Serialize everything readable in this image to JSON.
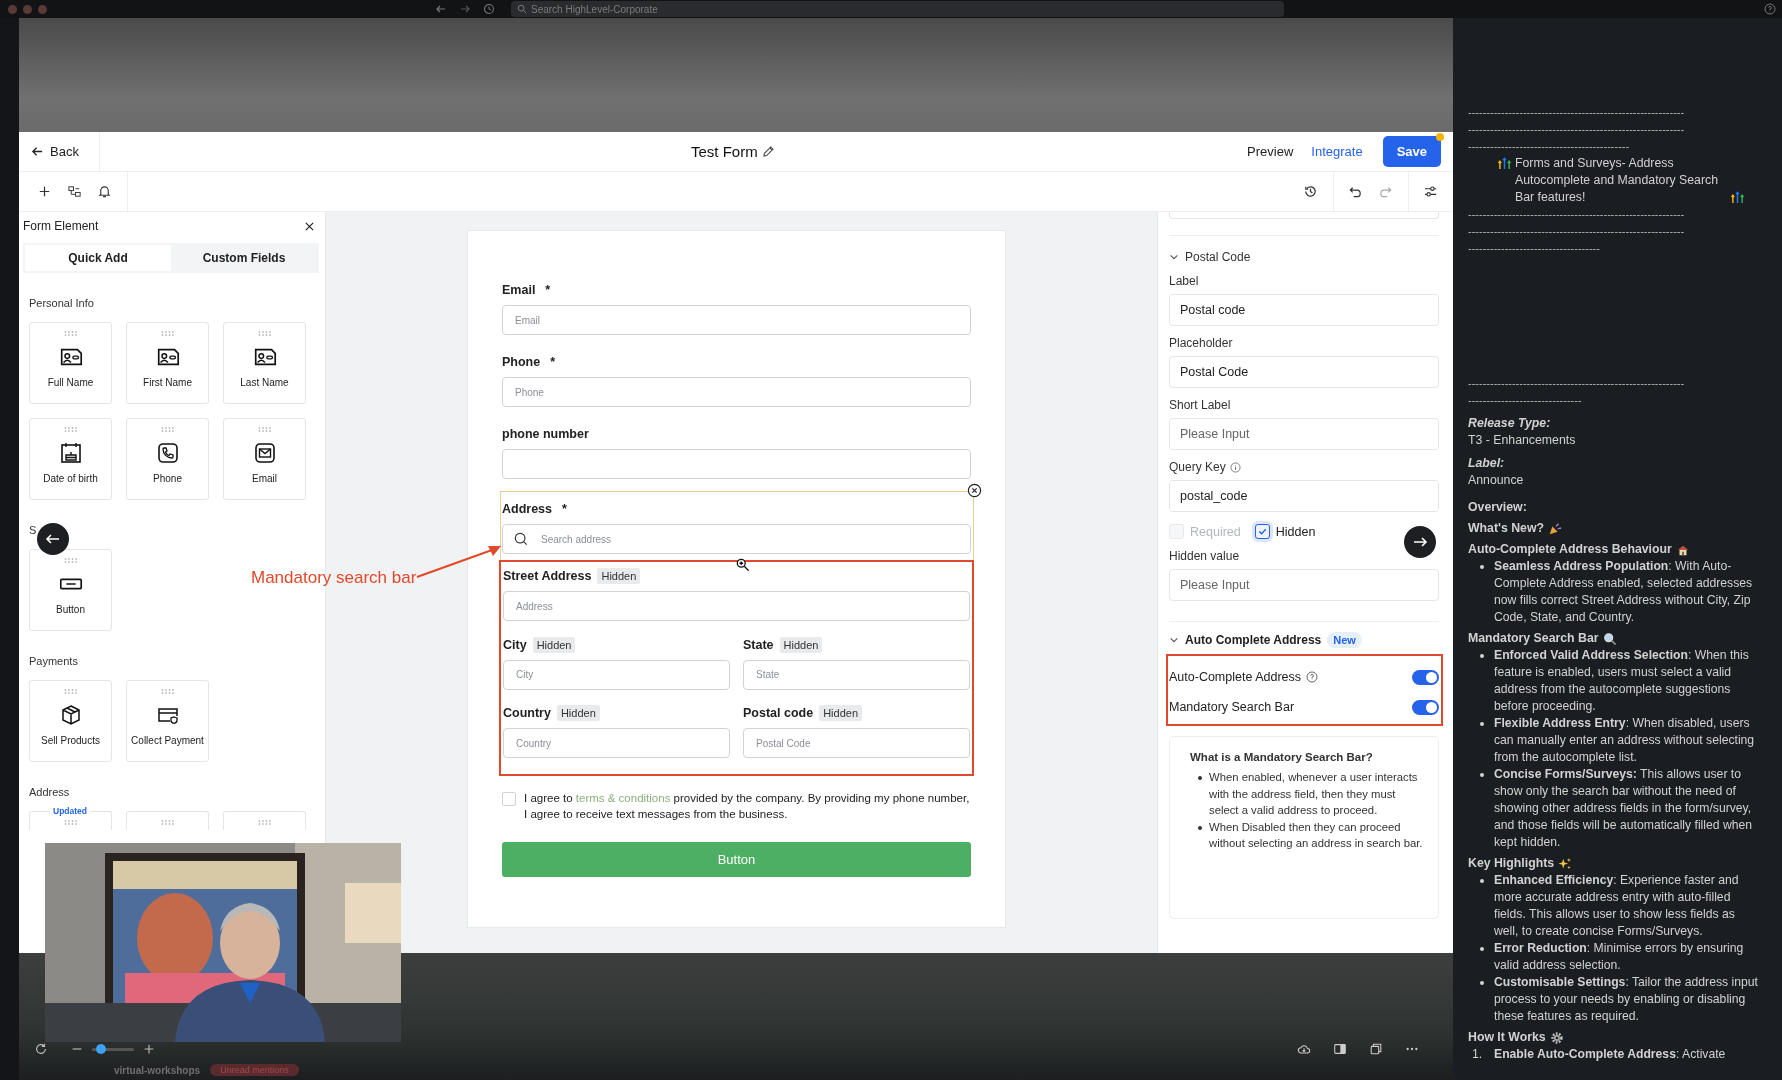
{
  "browser": {
    "search_placeholder": "Search HighLevel-Corporate"
  },
  "header": {
    "back": "Back",
    "title": "Test Form",
    "actions": [
      {
        "label": "Preview",
        "kind": "plain"
      },
      {
        "label": "Integrate",
        "kind": "link"
      },
      {
        "label": "Save",
        "kind": "primary"
      }
    ]
  },
  "left_panel": {
    "title": "Form Element",
    "tabs": [
      {
        "label": "Quick Add",
        "selected": true
      },
      {
        "label": "Custom Fields",
        "selected": false
      }
    ],
    "sections": [
      {
        "title": "Personal Info",
        "items": [
          {
            "label": "Full Name",
            "kind": "name"
          },
          {
            "label": "First Name",
            "kind": "name"
          },
          {
            "label": "Last Name",
            "kind": "name"
          },
          {
            "label": "Date of birth",
            "kind": "date"
          },
          {
            "label": "Phone",
            "kind": "phone"
          },
          {
            "label": "Email",
            "kind": "email"
          }
        ]
      },
      {
        "title": "S",
        "items": [
          {
            "label": "Button",
            "kind": "button"
          }
        ]
      },
      {
        "title": "Payments",
        "items": [
          {
            "label": "Sell Products",
            "kind": "product"
          },
          {
            "label": "Collect Payment",
            "kind": "payment"
          }
        ]
      },
      {
        "title": "Address",
        "items": [
          {
            "kind": "blank",
            "badge": "Updated"
          },
          {
            "kind": "blank"
          },
          {
            "kind": "blank"
          }
        ]
      }
    ]
  },
  "form": {
    "fields": [
      {
        "label": "Email",
        "required_mark": "*",
        "placeholder": "Email"
      },
      {
        "label": "Phone",
        "required_mark": "*",
        "placeholder": "Phone"
      },
      {
        "label": "phone number"
      }
    ],
    "address": {
      "label": "Address",
      "required_mark": "*",
      "search_placeholder": "Search address",
      "subfields": [
        {
          "label": "Street Address",
          "tag": "Hidden",
          "placeholder": "Address",
          "wide": true
        },
        {
          "label": "City",
          "tag": "Hidden",
          "placeholder": "City",
          "wide": false
        },
        {
          "label": "State",
          "tag": "Hidden",
          "placeholder": "State",
          "wide": false
        },
        {
          "label": "Country",
          "tag": "Hidden",
          "placeholder": "Country",
          "wide": false
        },
        {
          "label": "Postal code",
          "tag": "Hidden",
          "placeholder": "Postal Code",
          "wide": false
        }
      ]
    },
    "consent": {
      "checked": false,
      "before": "I agree to",
      "link": "terms & conditions",
      "after": "provided by the company. By providing my phone number, I agree to receive text messages from the business."
    },
    "submit": "Button"
  },
  "annotation": {
    "text": "Mandatory search bar"
  },
  "settings": {
    "section": "Postal Code",
    "fields": [
      {
        "label": "Label",
        "value": "Postal code",
        "info": false
      },
      {
        "label": "Placeholder",
        "value": "Postal Code",
        "info": false
      },
      {
        "label": "Short Label",
        "placeholder": "Please Input",
        "info": false
      },
      {
        "label": "Query Key",
        "value": "postal_code",
        "info": true
      }
    ],
    "checks": [
      {
        "label": "Required",
        "checked": false,
        "disabled": true
      },
      {
        "label": "Hidden",
        "checked": true,
        "disabled": false
      }
    ],
    "hidden_value": {
      "label": "Hidden value",
      "placeholder": "Please Input"
    },
    "autocomplete": {
      "title": "Auto Complete Address",
      "badge": "New",
      "toggles": [
        {
          "label": "Auto-Complete Address",
          "on": true,
          "info": true
        },
        {
          "label": "Mandatory Search Bar",
          "on": true,
          "info": false
        }
      ],
      "help": {
        "title": "What is a Mandatory Search Bar?",
        "bullets": [
          "When enabled, whenever a user interacts with the address field, then they must select a valid address to proceed.",
          "When Disabled then they can proceed without selecting an address in search bar."
        ]
      }
    }
  },
  "notes": {
    "rules_top": [
      "-----------------------------------------------------------",
      "-----------------------------------------------------------",
      "--------------------------------------------"
    ],
    "headline": "Forms and Surveys- Address Autocomplete and Mandatory Search Bar features!",
    "rules_mid": [
      "-----------------------------------------------------------",
      "-----------------------------------------------------------",
      "------------------------------------"
    ],
    "rules_low": [
      "-----------------------------------------------------------",
      "-------------------------------"
    ],
    "meta": [
      {
        "label": "Release Type:",
        "value": "T3 - Enhancements"
      },
      {
        "label": "Label:",
        "value": "Announce"
      }
    ],
    "overview": "Overview:",
    "whats_new": "What's New?",
    "sections": [
      {
        "title": "Auto-Complete Address Behaviour",
        "bullets": [
          {
            "text": "**Seamless Address Population**: With Auto-Complete Address enabled, selected addresses now fills correct Street Address without City, Zip Code, State, and Country."
          }
        ]
      },
      {
        "title": "Mandatory Search Bar",
        "bullets": [
          {
            "text": "**Enforced Valid Address Selection**: When this feature is enabled, users must select a valid address from the autocomplete suggestions before proceeding."
          },
          {
            "text": "**Flexible Address Entry**: When disabled, users can manually enter an address without selecting from the autocomplete list."
          },
          {
            "text": "**Concise Forms/Surveys:** This allows user to show only the search bar without the need of showing other address fields in the form/survey, and those fields will be automatically filled when kept hidden."
          }
        ]
      },
      {
        "title": "Key Highlights",
        "bullets": [
          {
            "text": "**Enhanced Efficiency**: Experience faster and more accurate address entry with auto-filled fields. This allows user to show less fields as well, to create concise Forms/Surveys."
          },
          {
            "text": "**Error Reduction**: Minimise errors by ensuring valid address selection."
          },
          {
            "text": "**Customisable Settings**: Tailor the address input process to your needs by enabling or disabling these features as required."
          }
        ]
      },
      {
        "title": "How It Works",
        "bullets": [
          {
            "number": "1.",
            "text": "**Enable Auto-Complete Address**: Activate"
          }
        ]
      }
    ]
  },
  "bottom": {
    "zoom": {
      "level": 0.12
    },
    "channel": "virtual-workshops",
    "mentions": "Unread mentions"
  }
}
